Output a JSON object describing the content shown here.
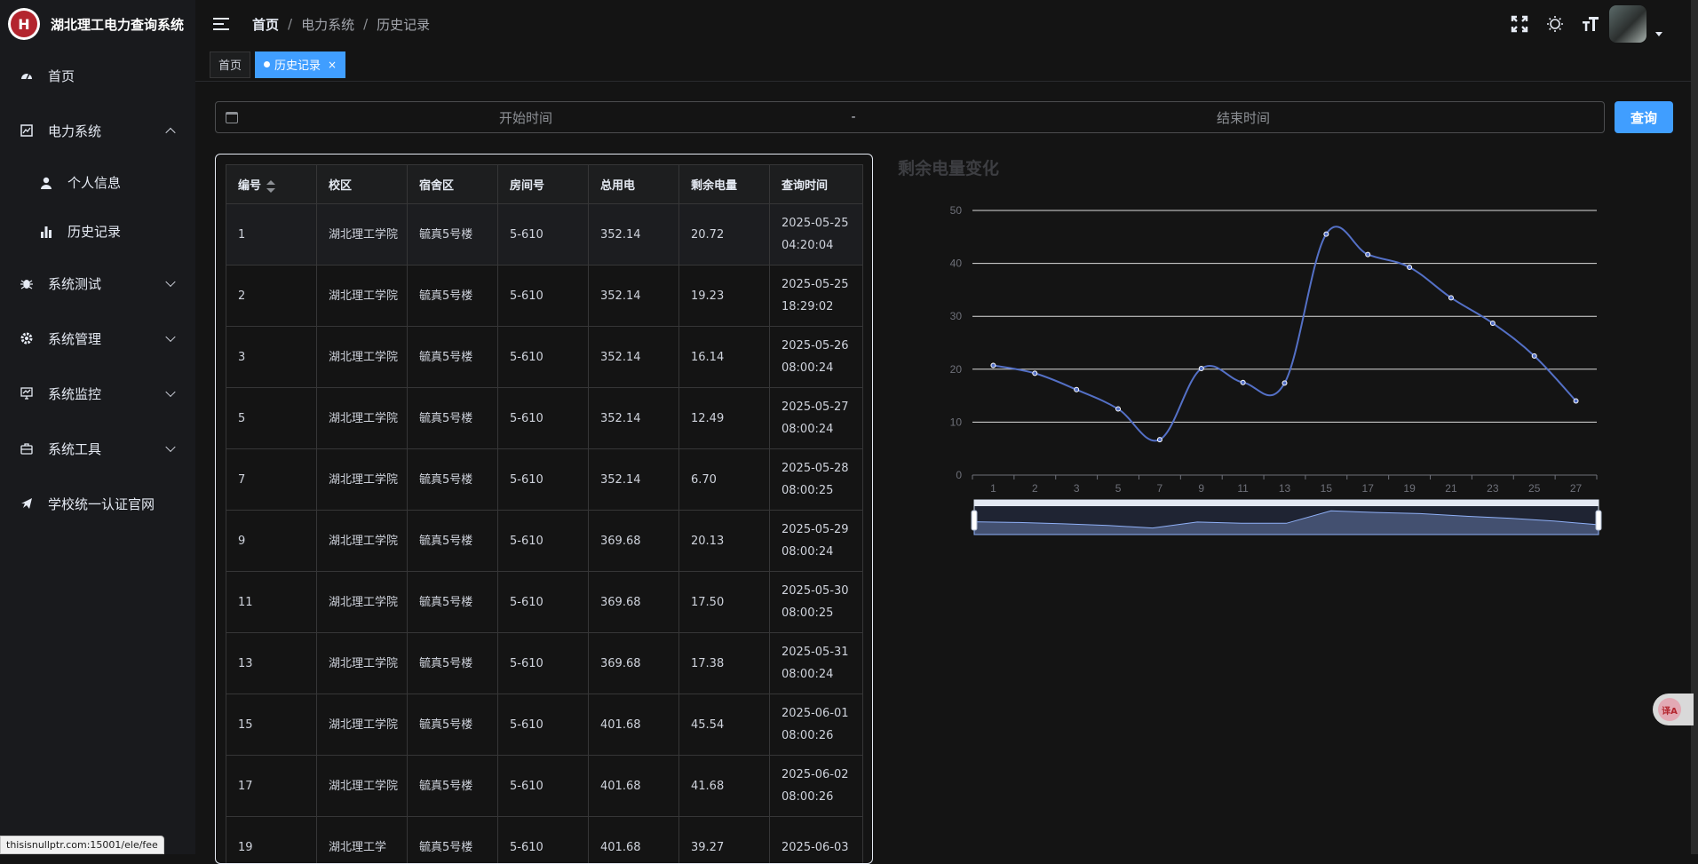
{
  "app": {
    "title": "湖北理工电力查询系统",
    "logo_text": "H"
  },
  "sidebar": {
    "items": [
      {
        "label": "首页",
        "icon": "dashboard-icon"
      },
      {
        "label": "电力系统",
        "icon": "chart-box-icon",
        "expanded": true
      },
      {
        "label": "个人信息",
        "icon": "user-icon",
        "sub": true
      },
      {
        "label": "历史记录",
        "icon": "bar-chart-icon",
        "sub": true
      },
      {
        "label": "系统测试",
        "icon": "bug-icon"
      },
      {
        "label": "系统管理",
        "icon": "gear-icon"
      },
      {
        "label": "系统监控",
        "icon": "monitor-icon"
      },
      {
        "label": "系统工具",
        "icon": "toolbox-icon"
      },
      {
        "label": "学校统一认证官网",
        "icon": "send-icon"
      }
    ]
  },
  "breadcrumb": {
    "items": [
      "首页",
      "电力系统",
      "历史记录"
    ],
    "separator": "/"
  },
  "tags": [
    {
      "label": "首页",
      "active": false
    },
    {
      "label": "历史记录",
      "active": true,
      "close": "×"
    }
  ],
  "filter": {
    "start_placeholder": "开始时间",
    "separator": "-",
    "end_placeholder": "结束时间",
    "search_label": "查询"
  },
  "table": {
    "headers": [
      "编号",
      "校区",
      "宿舍区",
      "房间号",
      "总用电",
      "剩余电量",
      "查询时间"
    ],
    "rows": [
      [
        "1",
        "湖北理工学院",
        "毓真5号楼",
        "5-610",
        "352.14",
        "20.72",
        "2025-05-25 04:20:04"
      ],
      [
        "2",
        "湖北理工学院",
        "毓真5号楼",
        "5-610",
        "352.14",
        "19.23",
        "2025-05-25 18:29:02"
      ],
      [
        "3",
        "湖北理工学院",
        "毓真5号楼",
        "5-610",
        "352.14",
        "16.14",
        "2025-05-26 08:00:24"
      ],
      [
        "5",
        "湖北理工学院",
        "毓真5号楼",
        "5-610",
        "352.14",
        "12.49",
        "2025-05-27 08:00:24"
      ],
      [
        "7",
        "湖北理工学院",
        "毓真5号楼",
        "5-610",
        "352.14",
        "6.70",
        "2025-05-28 08:00:25"
      ],
      [
        "9",
        "湖北理工学院",
        "毓真5号楼",
        "5-610",
        "369.68",
        "20.13",
        "2025-05-29 08:00:24"
      ],
      [
        "11",
        "湖北理工学院",
        "毓真5号楼",
        "5-610",
        "369.68",
        "17.50",
        "2025-05-30 08:00:25"
      ],
      [
        "13",
        "湖北理工学院",
        "毓真5号楼",
        "5-610",
        "369.68",
        "17.38",
        "2025-05-31 08:00:24"
      ],
      [
        "15",
        "湖北理工学院",
        "毓真5号楼",
        "5-610",
        "401.68",
        "45.54",
        "2025-06-01 08:00:26"
      ],
      [
        "17",
        "湖北理工学院",
        "毓真5号楼",
        "5-610",
        "401.68",
        "41.68",
        "2025-06-02 08:00:26"
      ],
      [
        "19",
        "湖北理工学",
        "毓真5号楼",
        "5-610",
        "401.68",
        "39.27",
        "2025-06-03"
      ]
    ]
  },
  "chart_data": {
    "type": "line",
    "title": "剩余电量变化",
    "categories": [
      "1",
      "2",
      "3",
      "5",
      "7",
      "9",
      "11",
      "13",
      "15",
      "17",
      "19",
      "21",
      "23",
      "25",
      "27"
    ],
    "series": [
      {
        "values": [
          20.72,
          19.23,
          16.14,
          12.49,
          6.7,
          20.13,
          17.5,
          17.38,
          45.54,
          41.68,
          39.27,
          33.5,
          28.7,
          22.5,
          14.0
        ]
      }
    ],
    "ylim": [
      0,
      50
    ],
    "yticks": [
      0,
      10,
      20,
      30,
      40,
      50
    ],
    "grid": true,
    "smooth": true,
    "color": "#5470c6",
    "data_zoom": true
  },
  "status_bar": {
    "url": "thisisnullptr.com:15001/ele/fee"
  },
  "translate_widget": {
    "label": "译A"
  }
}
